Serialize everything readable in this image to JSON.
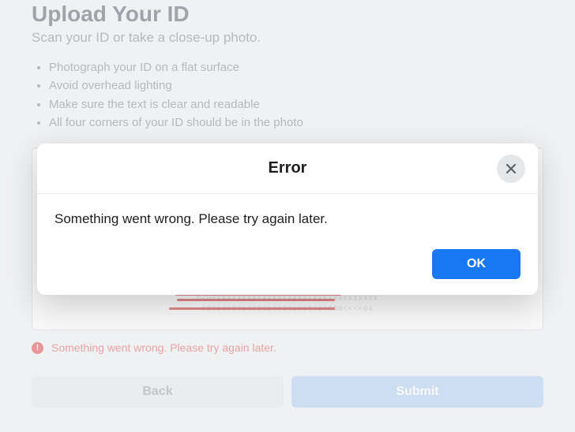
{
  "page": {
    "title": "Upload Your ID",
    "subtitle": "Scan your ID or take a close-up photo.",
    "tips": [
      "Photograph your ID on a flat surface",
      "Avoid overhead lighting",
      "Make sure the text is clear and readable",
      "All four corners of your ID should be in the photo"
    ],
    "inline_error": "Something went wrong. Please try again later.",
    "back_label": "Back",
    "submit_label": "Submit"
  },
  "modal": {
    "title": "Error",
    "message": "Something went wrong. Please try again later.",
    "ok_label": "OK"
  }
}
